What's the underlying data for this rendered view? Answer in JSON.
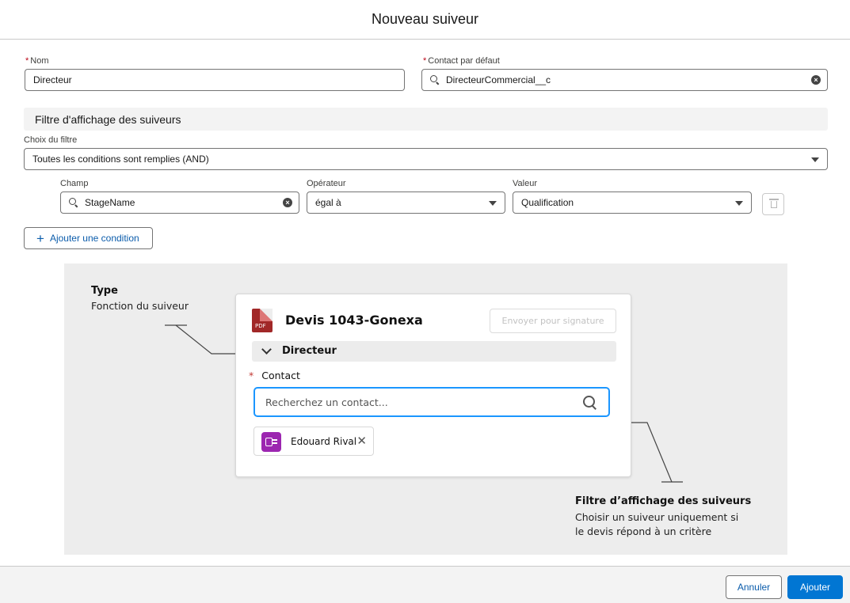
{
  "modal": {
    "title": "Nouveau suiveur"
  },
  "form": {
    "name": {
      "label": "Nom",
      "required_mark": "*",
      "value": "Directeur"
    },
    "default_contact": {
      "label": "Contact par défaut",
      "required_mark": "*",
      "value": "DirecteurCommercial__c"
    },
    "filter_section_title": "Filtre d'affichage des suiveurs",
    "filter_choice": {
      "label": "Choix du filtre",
      "value": "Toutes les conditions sont remplies (AND)"
    },
    "condition": {
      "field": {
        "label": "Champ",
        "value": "StageName"
      },
      "operator": {
        "label": "Opérateur",
        "value": "égal à"
      },
      "value": {
        "label": "Valeur",
        "value": "Qualification"
      }
    },
    "add_condition_label": "Ajouter une condition"
  },
  "illustration": {
    "type_annotation": {
      "title": "Type",
      "subtitle": "Fonction du suiveur"
    },
    "filter_annotation": {
      "title": "Filtre d’affichage des suiveurs",
      "line1": "Choisir un suiveur uniquement si",
      "line2": "le devis répond à un critère"
    },
    "card": {
      "pdf_badge": "PDF",
      "doc_title": "Devis 1043-Gonexa",
      "sign_button": "Envoyer pour signature",
      "accordion_label": "Directeur",
      "contact_label": "Contact",
      "contact_required_mark": "*",
      "contact_placeholder": "Recherchez un contact...",
      "selected_contact": "Edouard Rival"
    }
  },
  "footer": {
    "cancel_label": "Annuler",
    "submit_label": "Ajouter"
  },
  "colors": {
    "brand": "#0176d3",
    "link": "#0b5cab",
    "required": "#ba0517",
    "focus": "#1b96ff"
  },
  "icons": [
    "search-icon",
    "clear-icon",
    "chevron-down-icon",
    "trash-icon",
    "plus-icon",
    "pdf-icon",
    "contact-card-icon",
    "close-icon"
  ]
}
